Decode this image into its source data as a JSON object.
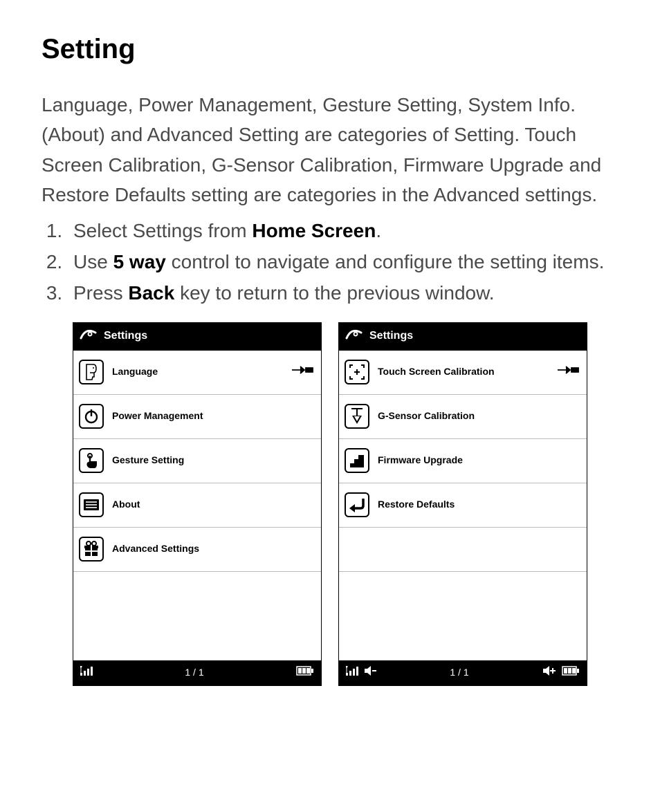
{
  "heading": "Setting",
  "intro": "Language, Power Management, Gesture Setting, System Info.(About) and Advanced Setting are categories of Setting. Touch Screen Calibration, G-Sensor Calibration, Firmware Upgrade and Restore Defaults setting are categories in the Advanced settings.",
  "steps": {
    "s1_a": "Select Settings from ",
    "s1_b": "Home Screen",
    "s1_c": ".",
    "s2_a": "Use ",
    "s2_b": "5 way",
    "s2_c": " control to navigate and configure the setting items.",
    "s3_a": "Press ",
    "s3_b": "Back",
    "s3_c": " key to return to the previous window."
  },
  "screen1": {
    "title": "Settings",
    "items": [
      {
        "label": "Language",
        "selected": true
      },
      {
        "label": "Power Management",
        "selected": false
      },
      {
        "label": "Gesture Setting",
        "selected": false
      },
      {
        "label": "About",
        "selected": false
      },
      {
        "label": "Advanced Settings",
        "selected": false
      }
    ],
    "page": "1 / 1"
  },
  "screen2": {
    "title": "Settings",
    "items": [
      {
        "label": "Touch Screen Calibration",
        "selected": true
      },
      {
        "label": "G-Sensor Calibration",
        "selected": false
      },
      {
        "label": "Firmware Upgrade",
        "selected": false
      },
      {
        "label": "Restore Defaults",
        "selected": false
      }
    ],
    "page": "1 / 1"
  }
}
